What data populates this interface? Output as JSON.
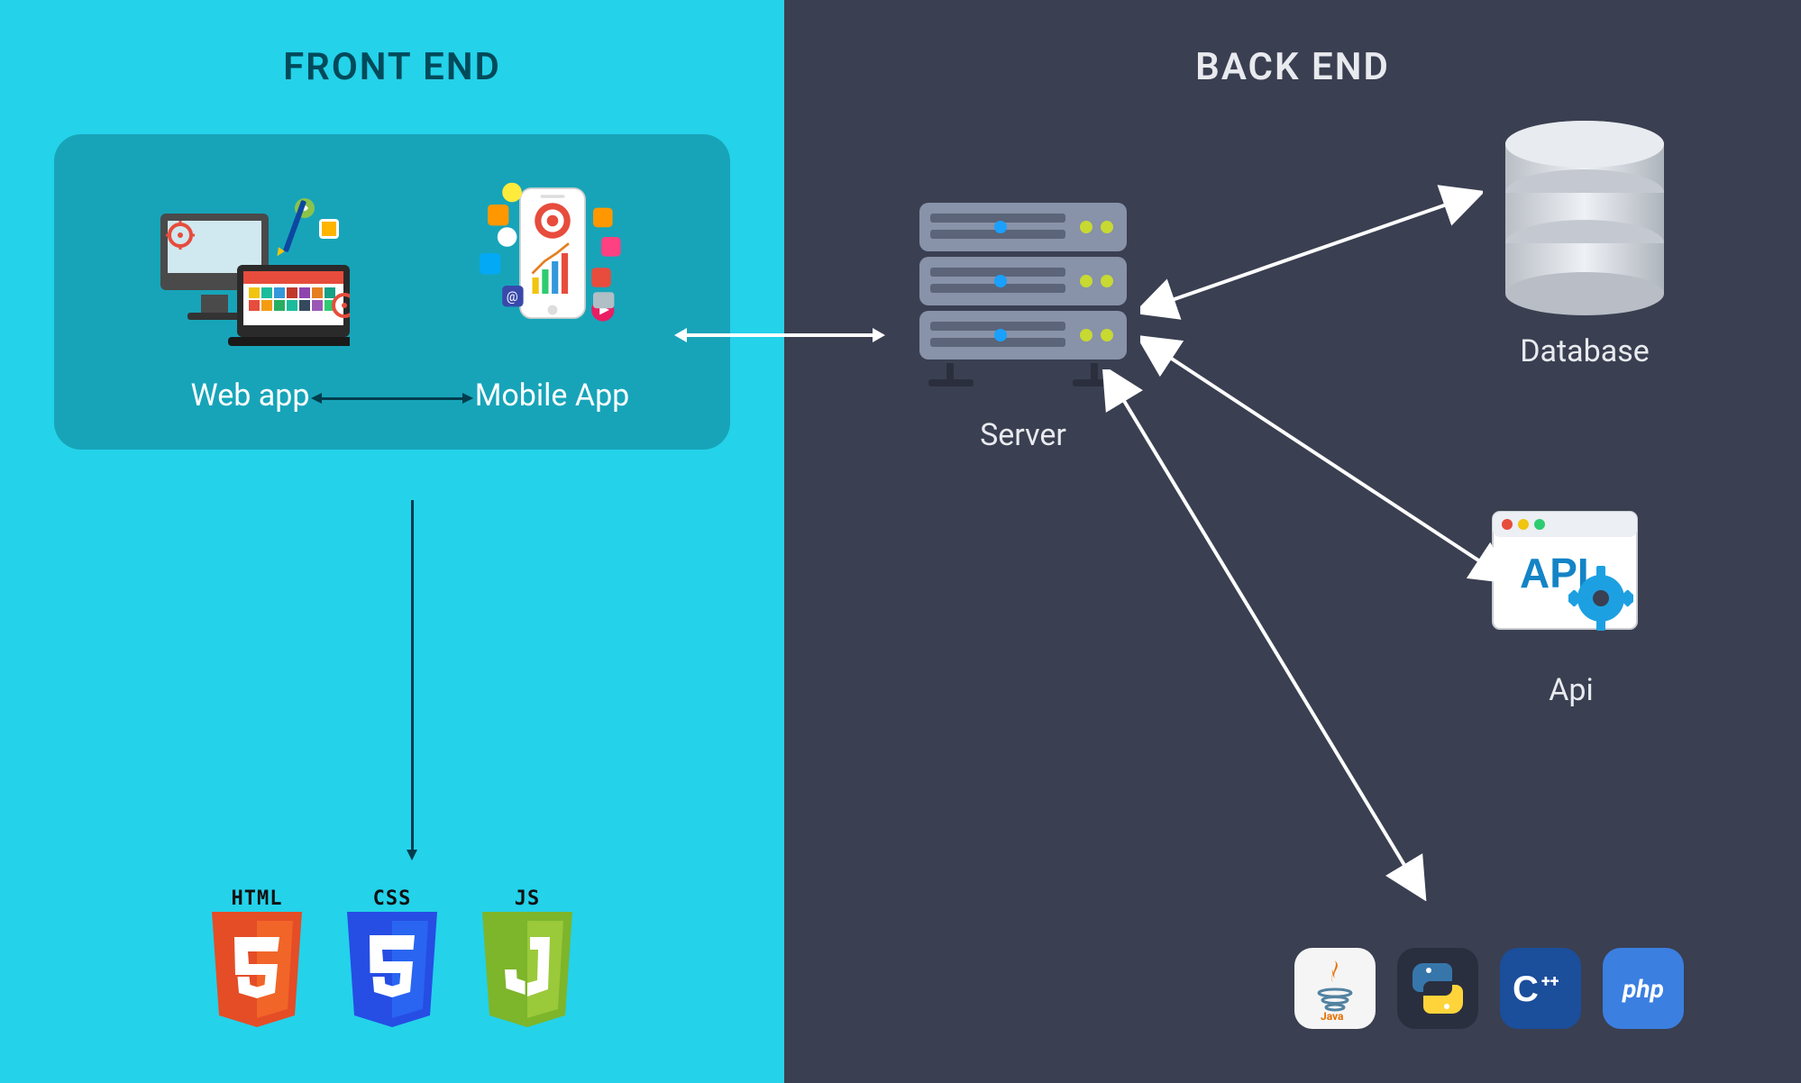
{
  "frontend": {
    "title": "FRONT END",
    "webapp_label": "Web app",
    "mobile_label": "Mobile App",
    "tech": {
      "html": "HTML",
      "css": "CSS",
      "js": "JS"
    }
  },
  "backend": {
    "title": "BACK END",
    "server_label": "Server",
    "database_label": "Database",
    "api_label": "Api",
    "api_badge": "API",
    "languages": {
      "java": "Java",
      "python": "Python",
      "cpp": "C++",
      "php": "php"
    }
  },
  "colors": {
    "frontend_bg": "#24d2ea",
    "backend_bg": "#3a3f51",
    "html_shield": "#e44d26",
    "css_shield": "#2965f1",
    "js_shield": "#7db52b"
  }
}
